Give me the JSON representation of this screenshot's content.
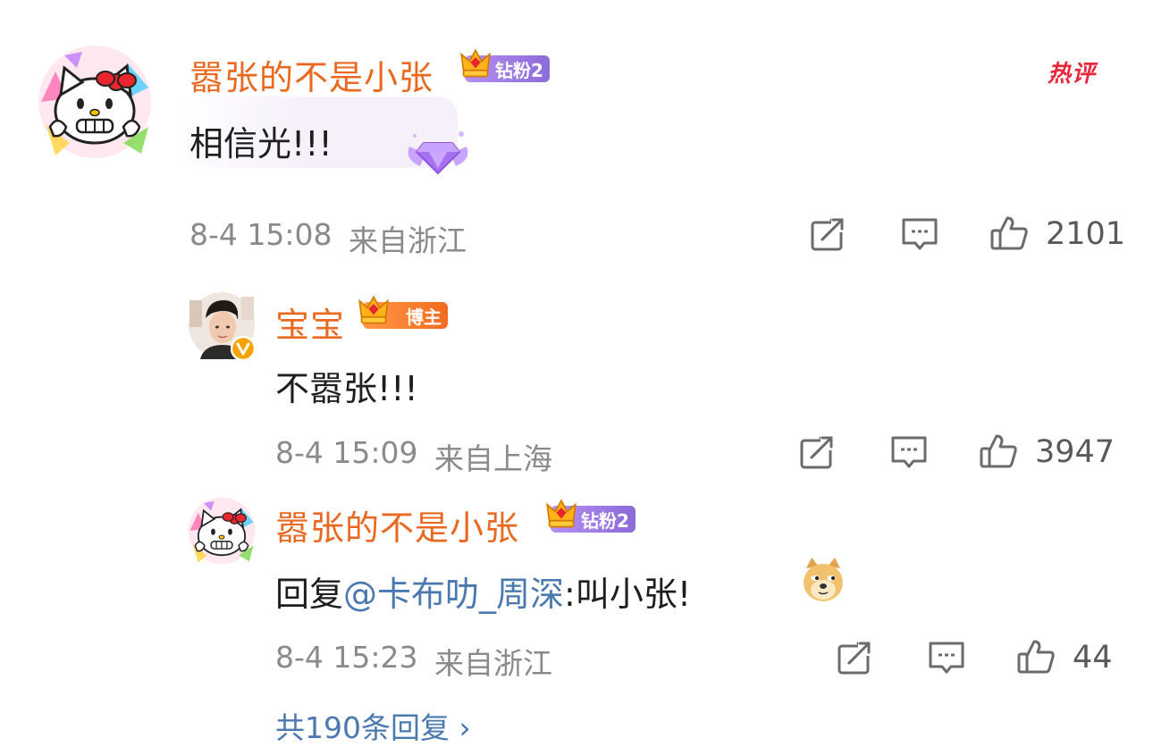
{
  "hot_label": "热评",
  "comment": {
    "username": "嚣张的不是小张",
    "badge": "钻粉2",
    "text": "相信光!!!",
    "time": "8-4 15:08",
    "location": "来自浙江",
    "likes": "2101"
  },
  "replies": [
    {
      "username": "宝宝",
      "badge": "博主",
      "text": "不嚣张!!!",
      "time": "8-4 15:09",
      "location": "来自上海",
      "likes": "3947",
      "verified": true
    },
    {
      "username": "嚣张的不是小张",
      "badge": "钻粉2",
      "reply_prefix": "回复",
      "mention": "@卡布叻_周深",
      "text": ":叫小张!",
      "emoji": "doge-emoji",
      "time": "8-4 15:23",
      "location": "来自浙江",
      "likes": "44"
    }
  ],
  "more_replies": "共190条回复 ›",
  "colors": {
    "username": "#e8691f",
    "mention": "#4a78b0",
    "meta": "#8a8a8a",
    "hot": "#e7273b",
    "fan_badge": "#9a78e4",
    "author_badge": "#f57d2e"
  },
  "icons": [
    "hello-kitty-avatar",
    "man-avatar",
    "crown-icon",
    "diamond-wings-icon",
    "share-icon",
    "comment-icon",
    "like-icon",
    "verified-v-icon",
    "doge-emoji"
  ]
}
